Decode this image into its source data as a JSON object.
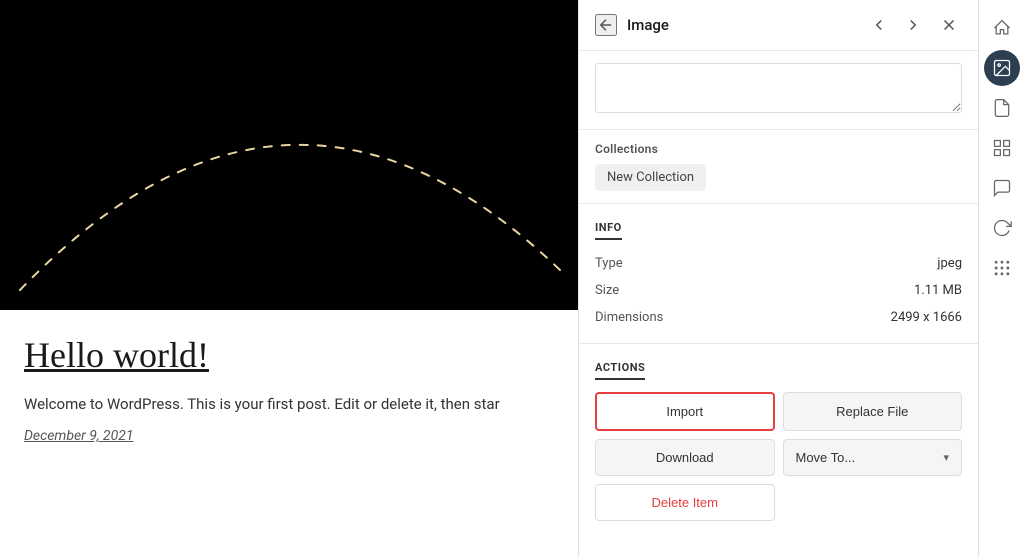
{
  "leftPanel": {
    "postTitle": "Hello world!",
    "postExcerpt": "Welcome to WordPress. This is your first post. Edit or delete it, then star",
    "postDate": "December 9, 2021"
  },
  "rightPanel": {
    "header": {
      "title": "Image",
      "backLabel": "←",
      "prevLabel": "‹",
      "nextLabel": "›",
      "closeLabel": "✕"
    },
    "textAreaPlaceholder": "",
    "collections": {
      "label": "Collections",
      "newCollectionLabel": "New Collection"
    },
    "info": {
      "sectionTitle": "INFO",
      "rows": [
        {
          "label": "Type",
          "value": "jpeg"
        },
        {
          "label": "Size",
          "value": "1.11 MB"
        },
        {
          "label": "Dimensions",
          "value": "2499 x 1666"
        }
      ]
    },
    "actions": {
      "sectionTitle": "ACTIONS",
      "importLabel": "Import",
      "replaceFileLabel": "Replace File",
      "downloadLabel": "Download",
      "moveToLabel": "Move To...",
      "deleteLabel": "Delete Item"
    }
  },
  "sidebarIcons": [
    {
      "name": "home-icon",
      "symbol": "⌂",
      "active": false
    },
    {
      "name": "image-icon",
      "symbol": "▣",
      "active": true
    },
    {
      "name": "file-icon",
      "symbol": "☐",
      "active": false
    },
    {
      "name": "gallery-icon",
      "symbol": "⬜",
      "active": false
    },
    {
      "name": "comment-icon",
      "symbol": "☁",
      "active": false
    },
    {
      "name": "refresh-icon",
      "symbol": "↻",
      "active": false
    },
    {
      "name": "grid-icon",
      "symbol": "⠿",
      "active": false
    }
  ]
}
